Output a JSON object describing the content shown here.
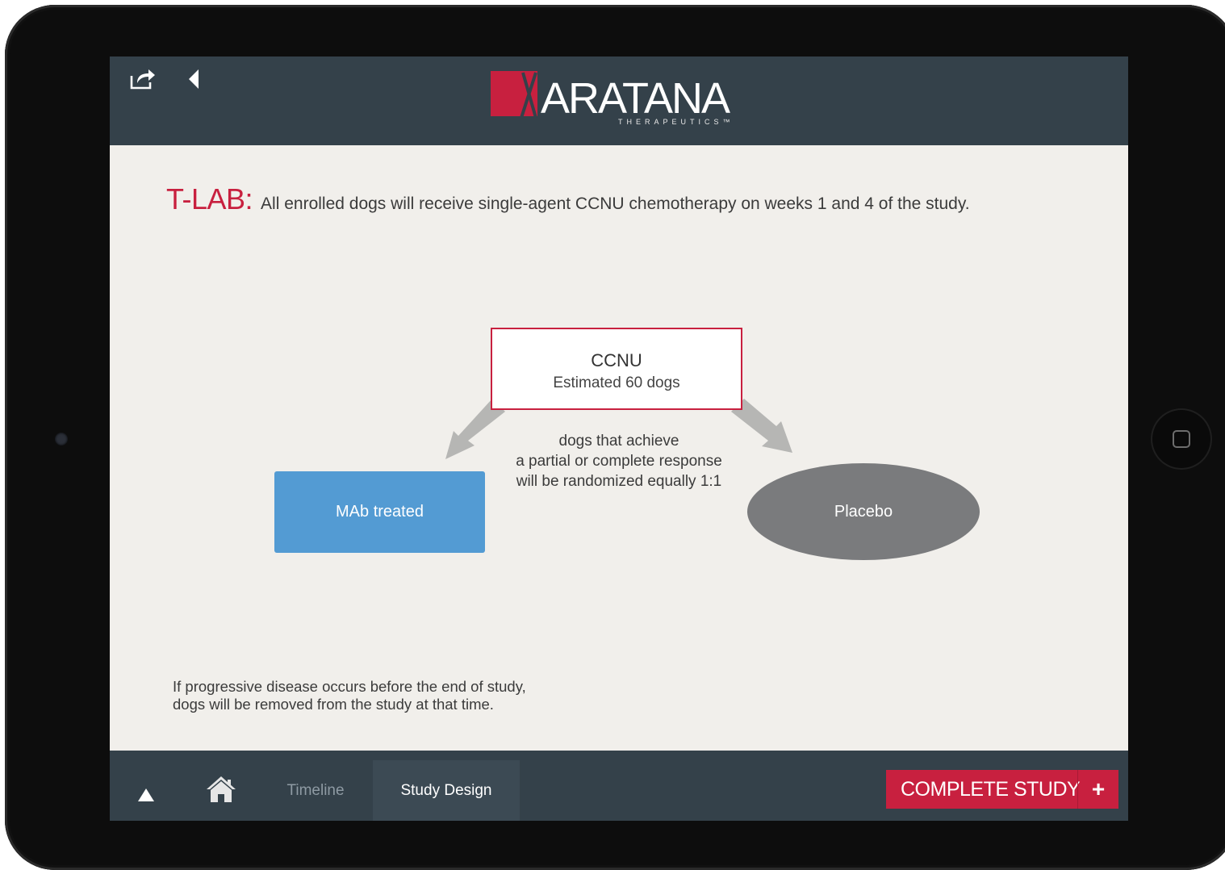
{
  "header": {
    "logo_text": "ARATANA",
    "logo_subtext": "THERAPEUTICS™",
    "share_icon": "share-icon",
    "back_icon": "chevron-left-icon"
  },
  "content": {
    "heading_label": "T-LAB:",
    "heading_text": "All enrolled dogs will receive single-agent CCNU chemotherapy on weeks 1 and 4 of the study.",
    "diagram": {
      "top_box_title": "CCNU",
      "top_box_subtitle": "Estimated 60 dogs",
      "note_lines": [
        "dogs that achieve",
        "a partial or complete response",
        "will be randomized equally 1:1"
      ],
      "left_box_label": "MAb treated",
      "right_ellipse_label": "Placebo"
    },
    "footnote_lines": [
      "If progressive disease occurs before the end of study,",
      "dogs will be removed from the study at that time."
    ]
  },
  "bottom_nav": {
    "up_icon": "triangle-up-icon",
    "home_icon": "home-icon",
    "tabs": [
      {
        "label": "Timeline",
        "active": false
      },
      {
        "label": "Study Design",
        "active": true
      }
    ],
    "complete_button": {
      "label": "COMPLETE STUDY",
      "icon": "+"
    }
  },
  "colors": {
    "accent": "#c8203f",
    "bar": "#34414a",
    "background": "#f1efeb",
    "mab": "#539bd3",
    "placebo": "#7a7b7d"
  }
}
